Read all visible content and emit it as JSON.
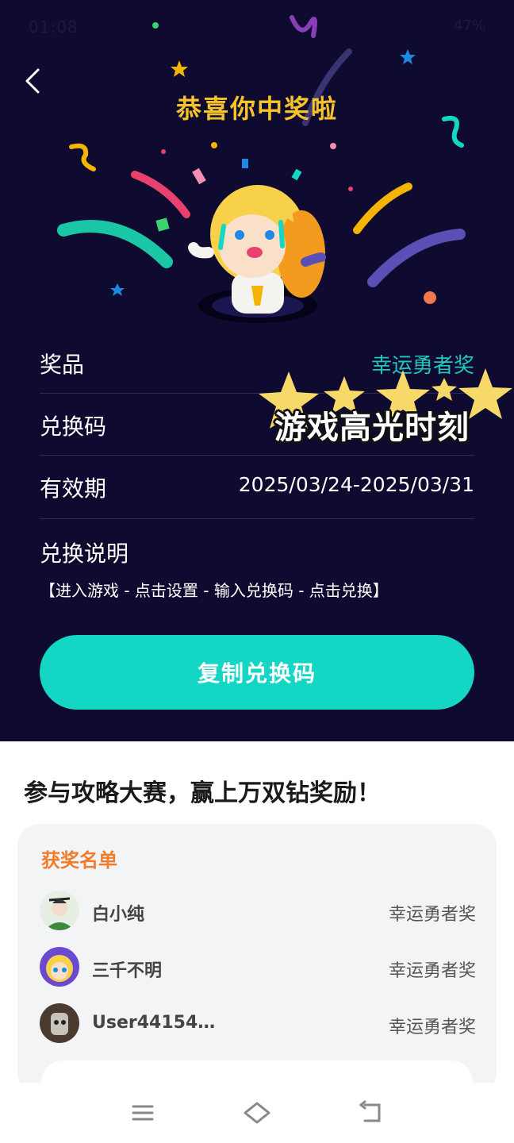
{
  "status_bar": {
    "time": "01:08",
    "battery": "47%"
  },
  "header": {
    "title": "恭喜你中奖啦"
  },
  "prize": {
    "prize_label": "奖品",
    "prize_value": "幸运勇者奖",
    "code_label": "兑换码",
    "validity_label": "有效期",
    "validity_value": "2025/03/24-2025/03/31",
    "instructions_label": "兑换说明",
    "instructions_text": "【进入游戏 - 点击设置 - 输入兑换码 - 点击兑换】",
    "copy_button": "复制兑换码"
  },
  "watermark": {
    "text": "游戏高光时刻"
  },
  "promo": {
    "title": "参与攻略大赛，赢上万双钻奖励！"
  },
  "winners": {
    "title": "获奖名单",
    "list": [
      {
        "name": "白小纯",
        "prize": "幸运勇者奖"
      },
      {
        "name": "三千不明",
        "prize": "幸运勇者奖"
      },
      {
        "name": "User44154…",
        "prize": "幸运勇者奖"
      }
    ]
  },
  "colors": {
    "hero_bg": "#0f0b30",
    "title": "#f6c42a",
    "accent": "#14d6c4",
    "winners_title": "#f07c2c"
  },
  "icons": {
    "back": "chevron-left-icon",
    "menu": "menu-icon",
    "home": "home-icon",
    "return": "back-icon"
  }
}
